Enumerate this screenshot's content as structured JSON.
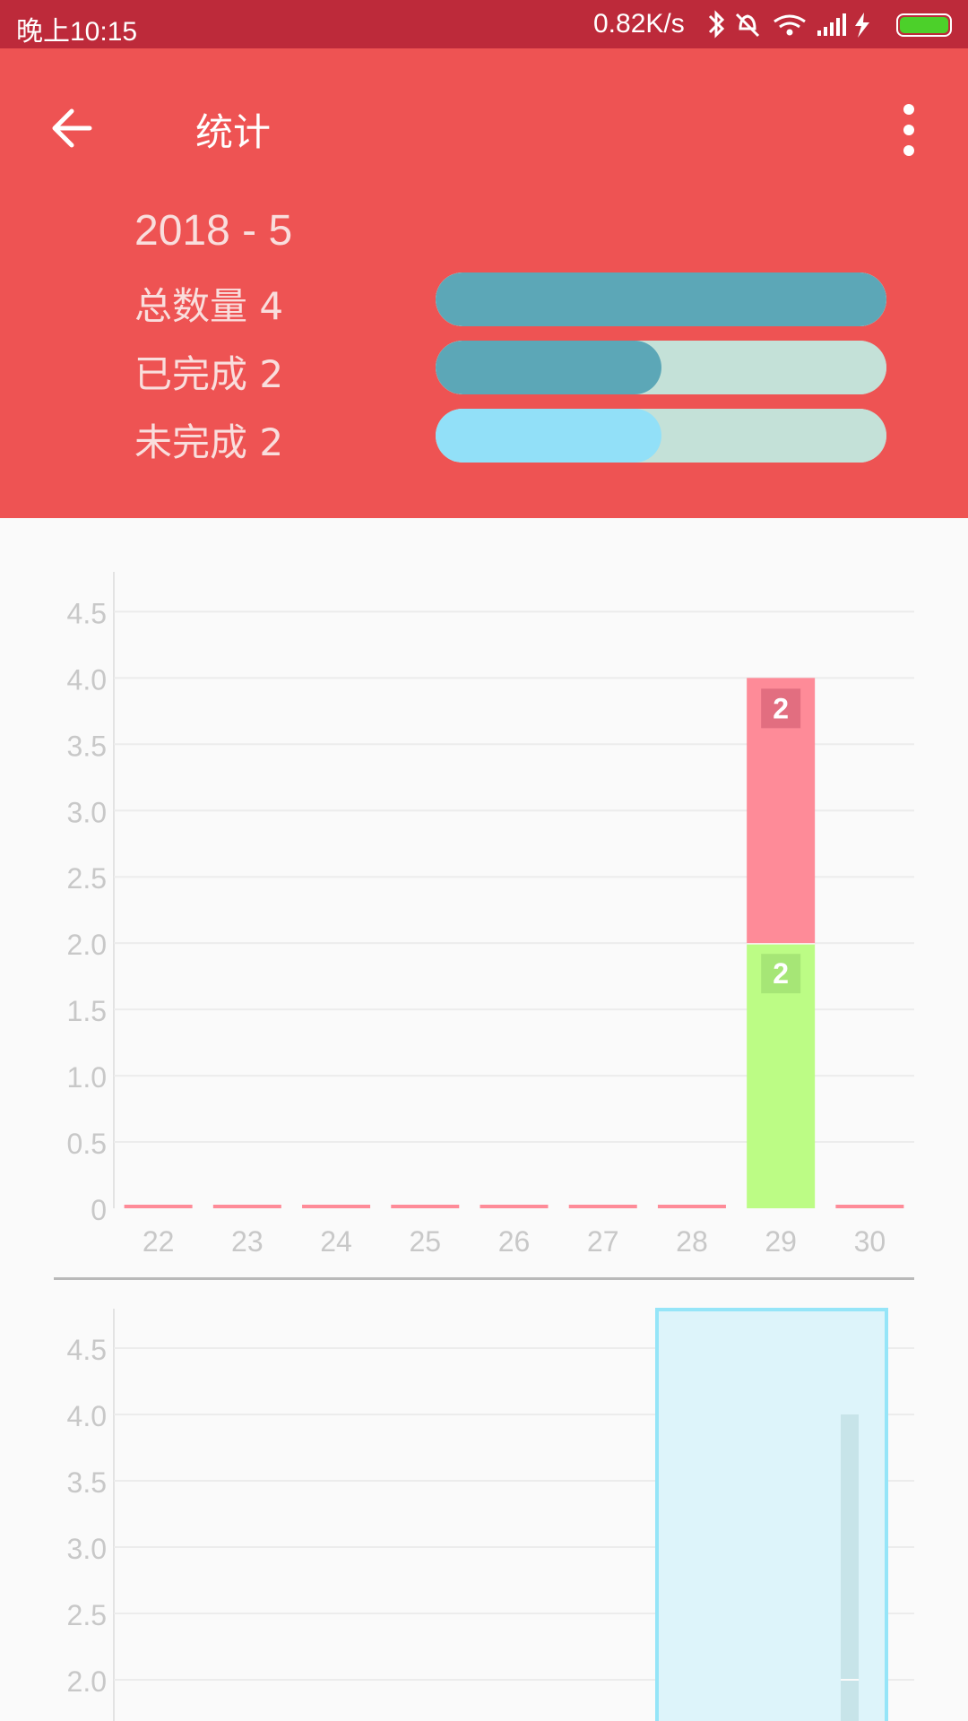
{
  "status_bar": {
    "time": "晚上10:15",
    "network_speed": "0.82K/s",
    "battery_color": "#4cd02a"
  },
  "app_bar": {
    "title": "统计",
    "back_icon": "arrow-left-icon",
    "menu_icon": "more-vertical-icon"
  },
  "summary": {
    "month": "2018 - 5",
    "rows": [
      {
        "label": "总数量 4",
        "fraction": 1.0,
        "fill_color": "#5ca7b7"
      },
      {
        "label": "已完成 2",
        "fraction": 0.5,
        "fill_color": "#5ca7b7"
      },
      {
        "label": "未完成 2",
        "fraction": 0.5,
        "fill_color": "#92e0f8"
      }
    ],
    "track_color": "#c4e1d8"
  },
  "chart_data": [
    {
      "type": "bar",
      "stacked": true,
      "categories": [
        "22",
        "23",
        "24",
        "25",
        "26",
        "27",
        "28",
        "29",
        "30"
      ],
      "yticks": [
        "0",
        "0.5",
        "1.0",
        "1.5",
        "2.0",
        "2.5",
        "3.0",
        "3.5",
        "4.0",
        "4.5"
      ],
      "ylim": [
        0,
        4.8
      ],
      "series": [
        {
          "values": [
            0,
            0,
            0,
            0,
            0,
            0,
            0,
            2,
            0
          ],
          "color": "#bcfc85",
          "label_color": "#a6e676"
        },
        {
          "values": [
            0,
            0,
            0,
            0,
            0,
            0,
            0,
            2,
            0
          ],
          "color": "#fe8b98",
          "label_color": "#e26e80"
        }
      ],
      "data_labels": [
        "2",
        "2"
      ],
      "grid": true
    },
    {
      "type": "bar",
      "yticks": [
        "2.0",
        "2.5",
        "3.0",
        "3.5",
        "4.0",
        "4.5"
      ],
      "ylim": [
        1.7,
        4.8
      ],
      "highlight_color": "#ddf4fa",
      "highlight_border": "#95e5f8",
      "values": [
        4
      ],
      "bar_color": "#c7e4e9",
      "grid": true
    }
  ]
}
